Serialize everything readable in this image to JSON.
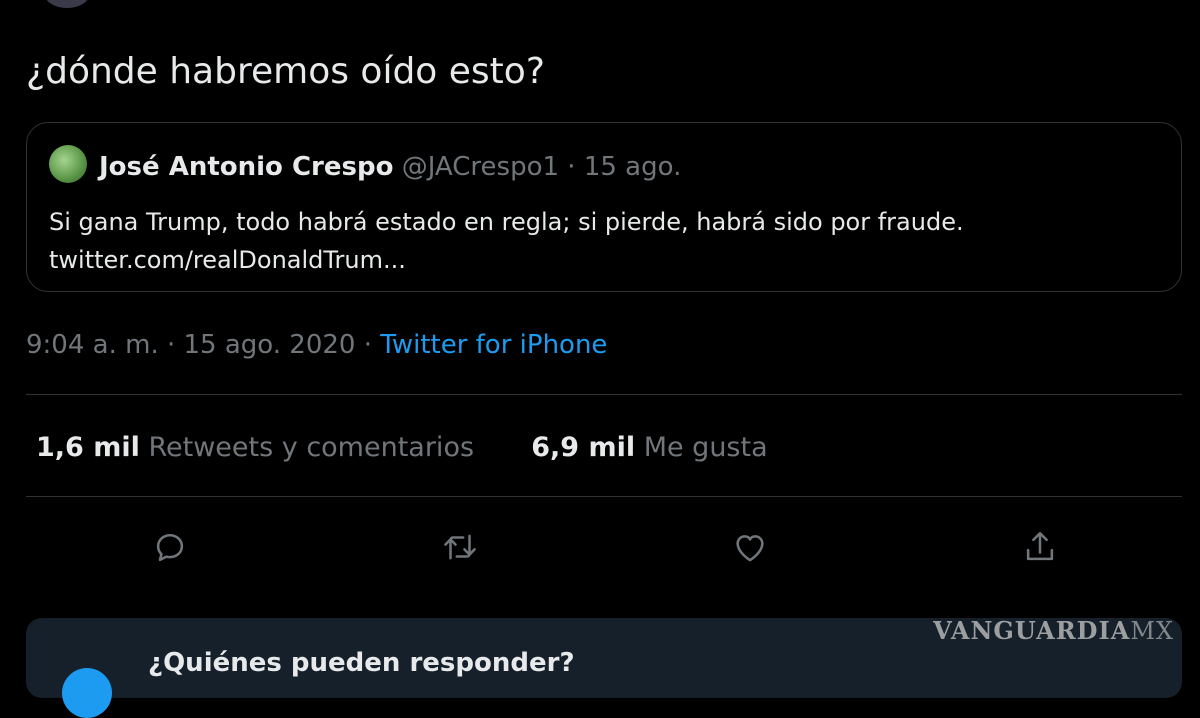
{
  "tweet": {
    "text": "¿dónde habremos oído esto?"
  },
  "quote": {
    "name": "José Antonio Crespo",
    "handle": "@JACrespo1",
    "separator": "·",
    "date": "15 ago.",
    "line1": "Si gana Trump, todo habrá estado en regla; si pierde, habrá sido por fraude.",
    "line2": "twitter.com/realDonaldTrum..."
  },
  "meta": {
    "time": "9:04 a. m.",
    "sep1": "·",
    "date": "15 ago. 2020",
    "sep2": "·",
    "source": "Twitter for iPhone"
  },
  "stats": {
    "retweets_count": "1,6 mil",
    "retweets_label": "Retweets y comentarios",
    "likes_count": "6,9 mil",
    "likes_label": "Me gusta"
  },
  "actions": {
    "icons": [
      "reply-icon",
      "retweet-icon",
      "like-icon",
      "share-icon"
    ]
  },
  "reply_prompt": {
    "heading": "¿Quiénes pueden responder?"
  },
  "watermark": {
    "brand": "VANGUARDIA",
    "suffix": "MX"
  },
  "colors": {
    "background": "#000000",
    "text": "#e7e9ea",
    "secondary": "#71767b",
    "accent": "#1d9bf0",
    "border": "#2f3336",
    "reply_box": "#15202b"
  }
}
